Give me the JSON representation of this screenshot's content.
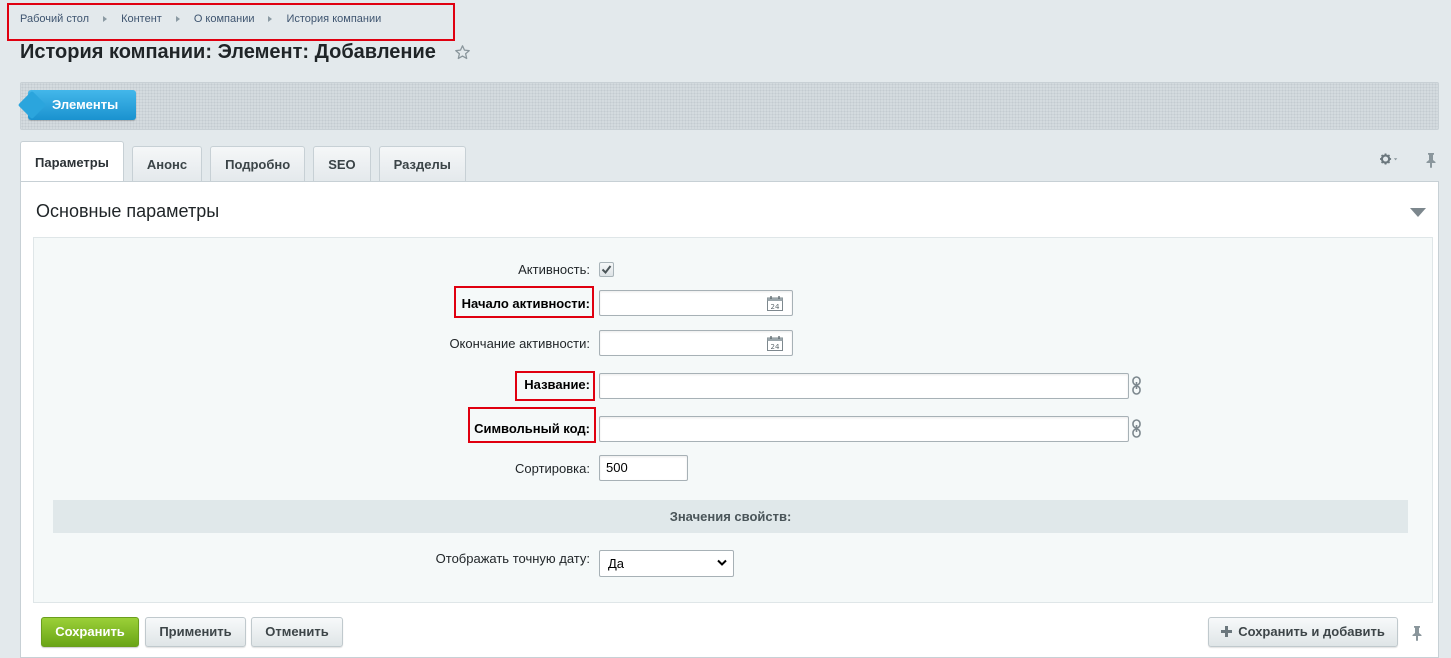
{
  "breadcrumb": {
    "items": [
      "Рабочий стол",
      "Контент",
      "О компании",
      "История компании"
    ]
  },
  "page": {
    "title": "История компании: Элемент: Добавление"
  },
  "toolbar": {
    "elements_label": "Элементы"
  },
  "tabs": [
    {
      "label": "Параметры",
      "active": true
    },
    {
      "label": "Анонс"
    },
    {
      "label": "Подробно"
    },
    {
      "label": "SEO"
    },
    {
      "label": "Разделы"
    }
  ],
  "section": {
    "title": "Основные параметры"
  },
  "form": {
    "active_label": "Активность:",
    "active_checked": true,
    "start_label": "Начало активности:",
    "start_value": "",
    "end_label": "Окончание активности:",
    "end_value": "",
    "name_label": "Название:",
    "name_value": "",
    "code_label": "Символьный код:",
    "code_value": "",
    "sort_label": "Сортировка:",
    "sort_value": "500",
    "props_header": "Значения свойств:",
    "exact_date_label": "Отображать точную дату:",
    "exact_date_value": "Да"
  },
  "footer": {
    "save_label": "Сохранить",
    "apply_label": "Применить",
    "cancel_label": "Отменить",
    "save_add_label": "Сохранить и добавить"
  },
  "colors": {
    "accent_blue": "#1a92cf",
    "save_green": "#6aa516",
    "highlight_red": "#e00010"
  }
}
